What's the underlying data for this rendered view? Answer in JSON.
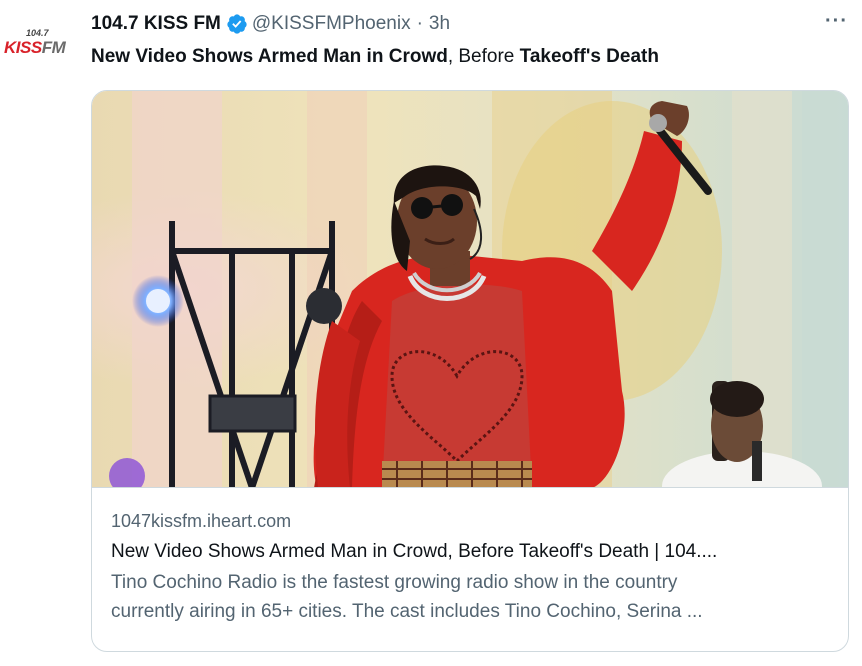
{
  "account": {
    "avatar_small_text": "104.7",
    "avatar_logo_kiss": "KISS",
    "avatar_logo_fm": "FM",
    "name": "104.7 KISS FM",
    "handle": "@KISSFMPhoenix",
    "separator": "·",
    "time": "3h"
  },
  "more_label": "···",
  "tweet": {
    "part1": "New Video Shows Armed Man in Crowd",
    "part2": ", Before ",
    "part3": "Takeoff's Death"
  },
  "card": {
    "domain": "1047kissfm.iheart.com",
    "title": "New Video Shows Armed Man in Crowd, Before Takeoff's Death | 104....",
    "description_line1": "Tino Cochino Radio is the fastest growing radio show in the country",
    "description_line2": "currently airing in 65+ cities. The cast includes Tino Cochino, Serina ..."
  },
  "colors": {
    "verified": "#1d9bf0",
    "jacket": "#d8261f",
    "brand_red": "#d9222a"
  },
  "icons": {
    "verified": "verified-badge-icon",
    "more": "more-options-icon"
  }
}
